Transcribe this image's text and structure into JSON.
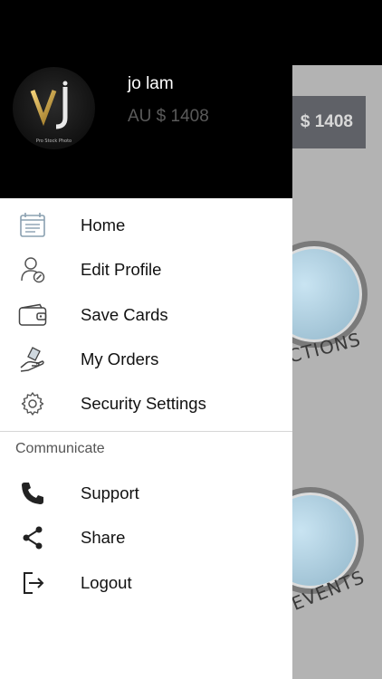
{
  "background": {
    "balance_text": "$ 1408",
    "caption_1": "CTIONS",
    "caption_2": "EVENTS"
  },
  "drawer": {
    "avatar": {
      "logo_text": "VJ",
      "tagline": "Pro Stock Photo"
    },
    "user": {
      "name": "jo  lam",
      "balance": "AU $ 1408"
    },
    "menu": [
      {
        "label": "Home",
        "icon": "home-list-icon"
      },
      {
        "label": "Edit Profile",
        "icon": "user-edit-icon"
      },
      {
        "label": "Save Cards",
        "icon": "wallet-icon"
      },
      {
        "label": "My Orders",
        "icon": "orders-hand-icon"
      },
      {
        "label": "Security Settings",
        "icon": "gear-icon"
      }
    ],
    "section_title": "Communicate",
    "communicate": [
      {
        "label": "Support",
        "icon": "phone-icon"
      },
      {
        "label": "Share",
        "icon": "share-icon"
      },
      {
        "label": "Logout",
        "icon": "logout-icon"
      }
    ]
  },
  "colors": {
    "header_bg": "#000000",
    "drawer_bg": "#ffffff",
    "overlay_bg": "#b3b3b3",
    "balance_muted": "#5a5a5a"
  }
}
